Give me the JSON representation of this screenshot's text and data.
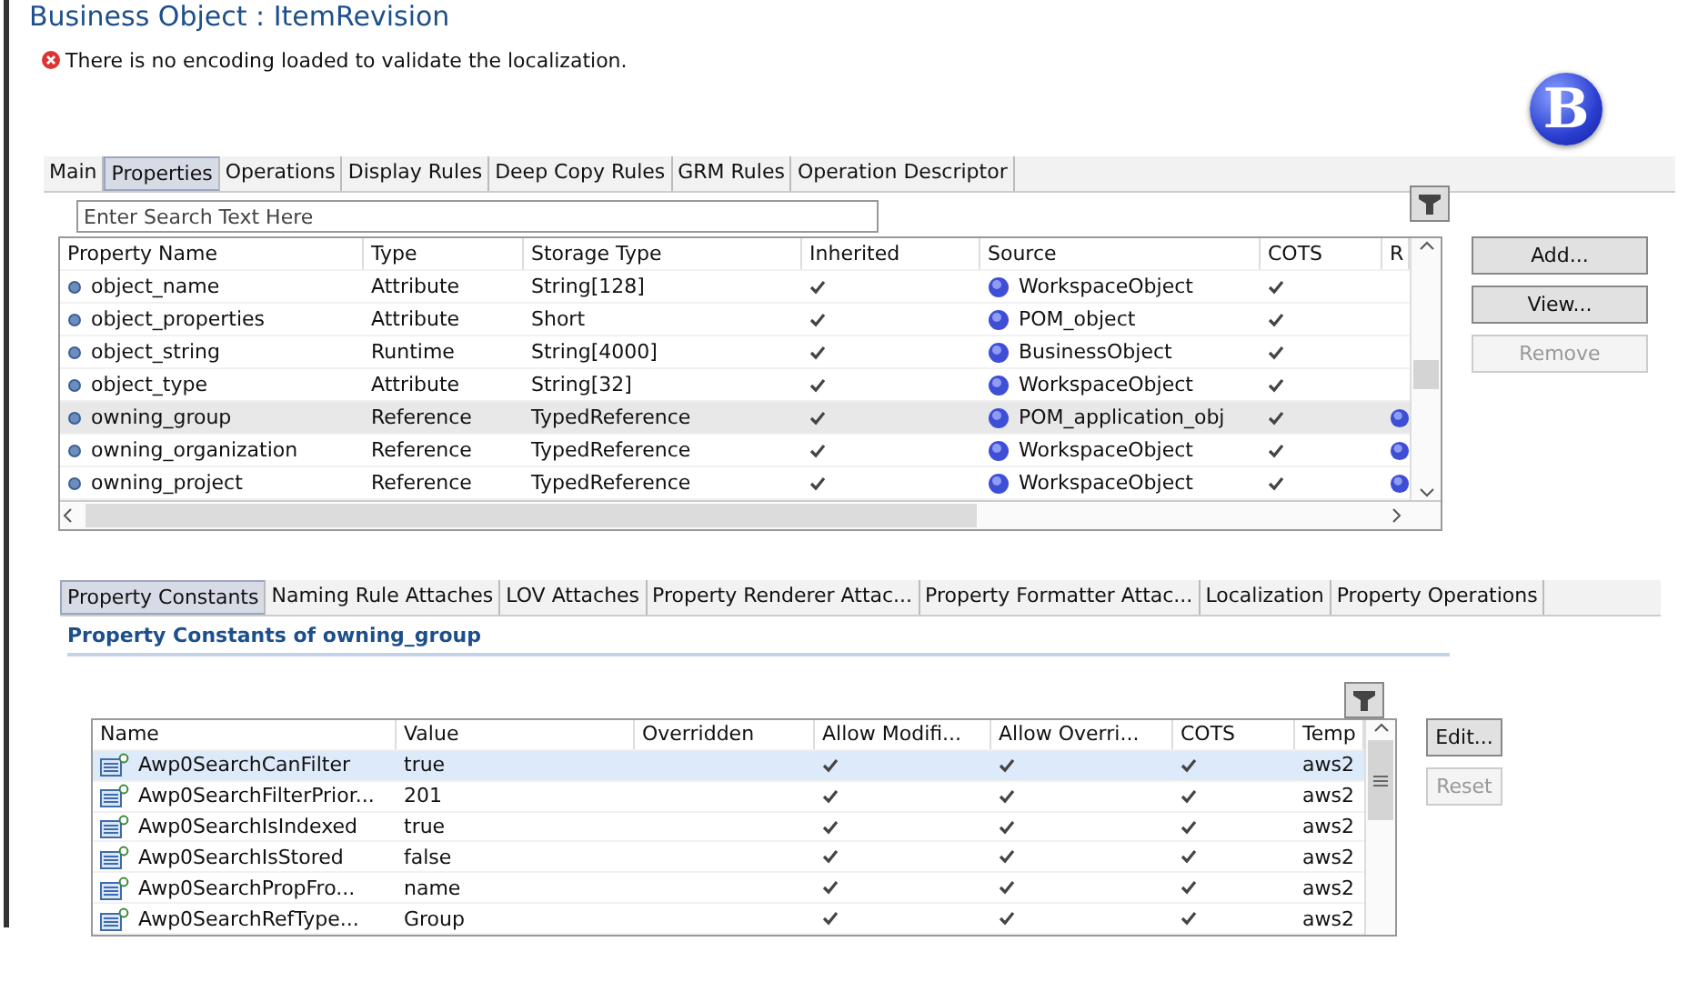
{
  "title": "Business Object : ItemRevision",
  "error": "There is no encoding loaded to validate the localization.",
  "logo": "B",
  "tabs": [
    {
      "label": "Main",
      "selected": false
    },
    {
      "label": "Properties",
      "selected": true
    },
    {
      "label": "Operations",
      "selected": false
    },
    {
      "label": "Display Rules",
      "selected": false
    },
    {
      "label": "Deep Copy Rules",
      "selected": false
    },
    {
      "label": "GRM Rules",
      "selected": false
    },
    {
      "label": "Operation Descriptor",
      "selected": false
    }
  ],
  "search": {
    "placeholder": "Enter Search Text Here"
  },
  "properties": {
    "columns": [
      "Property Name",
      "Type",
      "Storage Type",
      "Inherited",
      "Source",
      "COTS",
      "R"
    ],
    "rows": [
      {
        "name": "object_name",
        "type": "Attribute",
        "storage": "String[128]",
        "inherited": true,
        "source": "WorkspaceObject",
        "cots": true,
        "has_r": false,
        "selected": false
      },
      {
        "name": "object_properties",
        "type": "Attribute",
        "storage": "Short",
        "inherited": true,
        "source": "POM_object",
        "cots": true,
        "has_r": false,
        "selected": false
      },
      {
        "name": "object_string",
        "type": "Runtime",
        "storage": "String[4000]",
        "inherited": true,
        "source": "BusinessObject",
        "cots": true,
        "has_r": false,
        "selected": false
      },
      {
        "name": "object_type",
        "type": "Attribute",
        "storage": "String[32]",
        "inherited": true,
        "source": "WorkspaceObject",
        "cots": true,
        "has_r": false,
        "selected": false
      },
      {
        "name": "owning_group",
        "type": "Reference",
        "storage": "TypedReference",
        "inherited": true,
        "source": "POM_application_obj",
        "cots": true,
        "has_r": true,
        "selected": true
      },
      {
        "name": "owning_organization",
        "type": "Reference",
        "storage": "TypedReference",
        "inherited": true,
        "source": "WorkspaceObject",
        "cots": true,
        "has_r": true,
        "selected": false
      },
      {
        "name": "owning_project",
        "type": "Reference",
        "storage": "TypedReference",
        "inherited": true,
        "source": "WorkspaceObject",
        "cots": true,
        "has_r": true,
        "selected": false
      }
    ]
  },
  "property_buttons": [
    {
      "label": "Add...",
      "disabled": false
    },
    {
      "label": "View...",
      "disabled": false
    },
    {
      "label": "Remove",
      "disabled": true
    }
  ],
  "detail_tabs": [
    {
      "label": "Property Constants",
      "selected": true
    },
    {
      "label": "Naming Rule Attaches",
      "selected": false
    },
    {
      "label": "LOV Attaches",
      "selected": false
    },
    {
      "label": "Property Renderer Attac...",
      "selected": false
    },
    {
      "label": "Property Formatter Attac...",
      "selected": false
    },
    {
      "label": "Localization",
      "selected": false
    },
    {
      "label": "Property Operations",
      "selected": false
    }
  ],
  "detail_heading": "Property Constants of owning_group",
  "constants": {
    "columns": [
      "Name",
      "Value",
      "Overridden",
      "Allow Modifi...",
      "Allow Overri...",
      "COTS",
      "Temp"
    ],
    "rows": [
      {
        "name": "Awp0SearchCanFilter",
        "value": "true",
        "allow_modify": true,
        "allow_override": true,
        "cots": true,
        "template": "aws2",
        "selected": true
      },
      {
        "name": "Awp0SearchFilterPrior...",
        "value": "201",
        "allow_modify": true,
        "allow_override": true,
        "cots": true,
        "template": "aws2",
        "selected": false
      },
      {
        "name": "Awp0SearchIsIndexed",
        "value": "true",
        "allow_modify": true,
        "allow_override": true,
        "cots": true,
        "template": "aws2",
        "selected": false
      },
      {
        "name": "Awp0SearchIsStored",
        "value": "false",
        "allow_modify": true,
        "allow_override": true,
        "cots": true,
        "template": "aws2",
        "selected": false
      },
      {
        "name": "Awp0SearchPropFro...",
        "value": "name",
        "allow_modify": true,
        "allow_override": true,
        "cots": true,
        "template": "aws2",
        "selected": false
      },
      {
        "name": "Awp0SearchRefType...",
        "value": "Group",
        "allow_modify": true,
        "allow_override": true,
        "cots": true,
        "template": "aws2",
        "selected": false
      }
    ]
  },
  "constant_buttons": [
    {
      "label": "Edit...",
      "disabled": false
    },
    {
      "label": "Reset",
      "disabled": true
    }
  ]
}
